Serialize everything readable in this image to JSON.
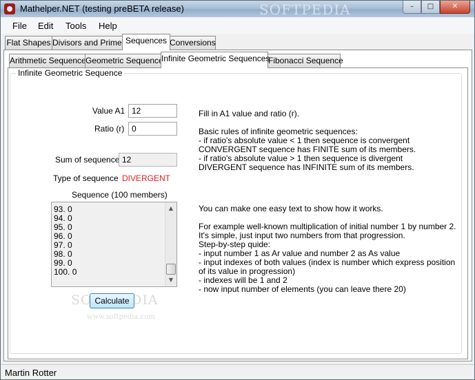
{
  "window": {
    "title": "Mathelper.NET (testing preBETA release)",
    "buttons": {
      "minimize": "–",
      "maximize": "□",
      "close": "✕"
    }
  },
  "menu": [
    "File",
    "Edit",
    "Tools",
    "Help"
  ],
  "main_tabs": [
    "Flat Shapes",
    "Divisors and Primes",
    "Sequences",
    "Conversions"
  ],
  "main_tab_active": "Sequences",
  "sub_tabs": [
    "Arithmetic Sequence",
    "Geometric Sequence",
    "Infinite Geometric Sequences",
    "Fibonacci Sequence"
  ],
  "sub_tab_active": "Infinite Geometric Sequences",
  "group_title": "Infinite Geometric Sequence",
  "form": {
    "value_a1_label": "Value A1",
    "value_a1": "12",
    "ratio_label": "Ratio (r)",
    "ratio": "0",
    "sum_label": "Sum of sequence",
    "sum_value": "12",
    "type_label": "Type of sequence",
    "type_value": "DIVERGENT",
    "sequence_label": "Sequence (100 members)"
  },
  "sequence_items": [
    "93. 0",
    "94. 0",
    "95. 0",
    "96. 0",
    "97. 0",
    "98. 0",
    "99. 0",
    "100. 0"
  ],
  "calculate_label": "Calculate",
  "help_text": {
    "block1": [
      "Fill in A1 value and ratio (r).",
      "",
      "Basic rules of infinite geometric sequences:",
      "- if ratio's absolute value < 1 then sequence is convergent",
      "CONVERGENT sequence has FINITE sum of its members.",
      "- if ratio's absolute value > 1 then sequence is divergent",
      "DIVERGENT sequence has INFINITE sum of its members."
    ],
    "block2": [
      "You can make one easy text to show how it works.",
      "",
      "For example well-known multiplication of initial number 1 by number 2.",
      "It's simple, just input two numbers from that progression.",
      "Step-by-step quide:",
      "- input number 1 as Ar value and number 2 as As value",
      "- input indexes of both values (index is number which express position",
      "of its value in progression)",
      "- indexes will be 1 and 2",
      "- now input number of elements (you can leave there 20)"
    ]
  },
  "status": "Martin Rotter",
  "watermarks": [
    "SOFTPEDIA",
    "SOFTPEDIA",
    "www.softpedia.com"
  ],
  "icons": {
    "app": "mathelper-app-icon",
    "scroll_up": "▲",
    "scroll_down": "▼"
  }
}
